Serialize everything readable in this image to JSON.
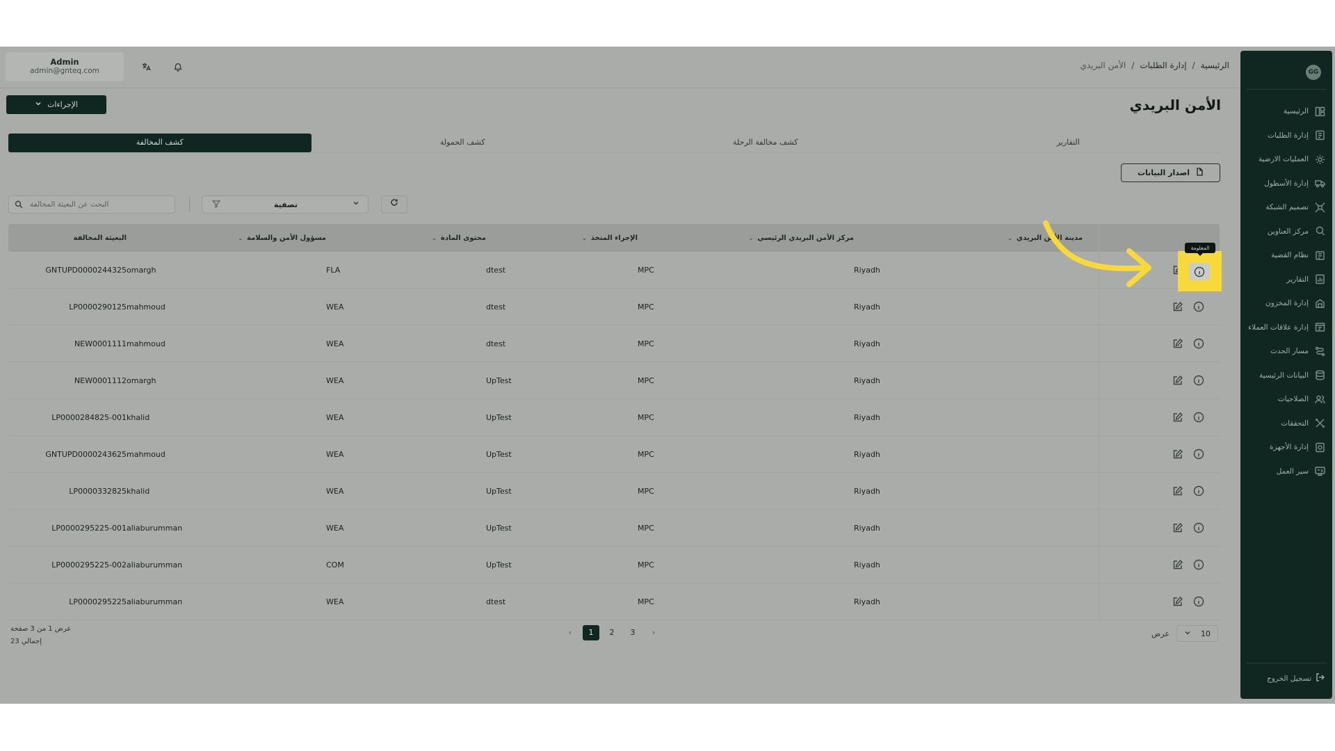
{
  "user": {
    "name": "Admin",
    "email": "admin@gnteq.com"
  },
  "breadcrumb": {
    "home": "الرئيسية",
    "orders": "إدارة الطلبات",
    "current": "الأمن البريدي"
  },
  "page": {
    "title": "الأمن البريدي",
    "actions_label": "الإجراءات",
    "export_label": "اصدار البيانات"
  },
  "logo_text": "GG",
  "tabs": [
    {
      "label": "كشف المخالفة",
      "active": true
    },
    {
      "label": "كشف الحمولة"
    },
    {
      "label": "كشف مخالفة الرحلة"
    },
    {
      "label": "التقارير"
    }
  ],
  "search": {
    "placeholder": "البحث عن البعيثة المخالفة"
  },
  "filter": {
    "label": "تصفية"
  },
  "table": {
    "headers": {
      "city": "مدينة الأمن البريدي",
      "center": "مركز الأمن البريدي الرئيسي",
      "procedure": "الإجراء المتخذ",
      "content": "محتوى المادة",
      "responsible": "مسؤول الأمن والسلامة",
      "shipment": "البعيثة المخالفة"
    },
    "rows": [
      {
        "city": "Riyadh",
        "center": "MPC",
        "procedure": "dtest",
        "content": "FLA",
        "responsible": "omargh",
        "shipment": "GNTUPD0000244325"
      },
      {
        "city": "Riyadh",
        "center": "MPC",
        "procedure": "dtest",
        "content": "WEA",
        "responsible": "mahmoud",
        "shipment": "LP0000290125"
      },
      {
        "city": "Riyadh",
        "center": "MPC",
        "procedure": "dtest",
        "content": "WEA",
        "responsible": "mahmoud",
        "shipment": "NEW0001111"
      },
      {
        "city": "Riyadh",
        "center": "MPC",
        "procedure": "UpTest",
        "content": "WEA",
        "responsible": "omargh",
        "shipment": "NEW0001112"
      },
      {
        "city": "Riyadh",
        "center": "MPC",
        "procedure": "UpTest",
        "content": "WEA",
        "responsible": "khalid",
        "shipment": "LP0000284825-001"
      },
      {
        "city": "Riyadh",
        "center": "MPC",
        "procedure": "UpTest",
        "content": "WEA",
        "responsible": "mahmoud",
        "shipment": "GNTUPD0000243625"
      },
      {
        "city": "Riyadh",
        "center": "MPC",
        "procedure": "UpTest",
        "content": "WEA",
        "responsible": "khalid",
        "shipment": "LP0000332825"
      },
      {
        "city": "Riyadh",
        "center": "MPC",
        "procedure": "UpTest",
        "content": "WEA",
        "responsible": "aliaburumman",
        "shipment": "LP0000295225-001"
      },
      {
        "city": "Riyadh",
        "center": "MPC",
        "procedure": "UpTest",
        "content": "COM",
        "responsible": "aliaburumman",
        "shipment": "LP0000295225-002"
      },
      {
        "city": "Riyadh",
        "center": "MPC",
        "procedure": "dtest",
        "content": "WEA",
        "responsible": "aliaburumman",
        "shipment": "LP0000295225"
      }
    ]
  },
  "tooltip": "المعلومة",
  "pagination": {
    "info": "عرض 1 من 3 صفحة",
    "total": "إجمالي 23",
    "pages": [
      "1",
      "2",
      "3"
    ],
    "current": "1",
    "per_page_label": "عرض",
    "per_page_value": "10"
  },
  "sidebar": {
    "items": [
      {
        "label": "الرئيسية",
        "icon": "dashboard-icon"
      },
      {
        "label": "إدارة الطلبات",
        "icon": "orders-icon"
      },
      {
        "label": "العمليات الارضية",
        "icon": "ground-ops-icon"
      },
      {
        "label": "إدارة الأسطول",
        "icon": "fleet-icon"
      },
      {
        "label": "تصميم الشبكة",
        "icon": "network-icon"
      },
      {
        "label": "مركز العناوين",
        "icon": "address-icon"
      },
      {
        "label": "نظام القضية",
        "icon": "case-icon"
      },
      {
        "label": "التقارير",
        "icon": "reports-icon"
      },
      {
        "label": "إدارة المخزون",
        "icon": "inventory-icon"
      },
      {
        "label": "إدارة علاقات العملاء",
        "icon": "crm-icon"
      },
      {
        "label": "مسار الحدث",
        "icon": "event-path-icon"
      },
      {
        "label": "البيانات الرئيسية",
        "icon": "master-data-icon"
      },
      {
        "label": "الصلاحيات",
        "icon": "permissions-icon"
      },
      {
        "label": "التحققات",
        "icon": "validations-icon"
      },
      {
        "label": "إدارة الأجهزة",
        "icon": "devices-icon"
      },
      {
        "label": "سير العمل",
        "icon": "workflow-icon"
      }
    ],
    "logout_label": "تسجيل الخروج"
  },
  "colors": {
    "sidebar_bg": "#0f2720",
    "highlight": "#f7d93a",
    "overlay_bg": "#a9aca9"
  }
}
